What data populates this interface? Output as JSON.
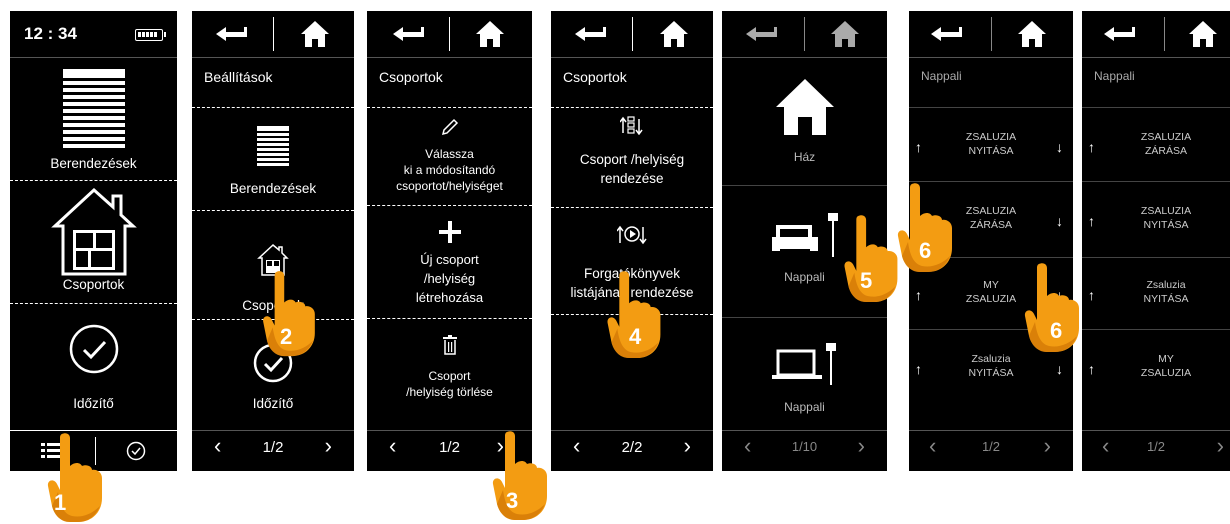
{
  "screen1": {
    "time": "12 : 34",
    "items": [
      "Berendezések",
      "Csoportok",
      "Időzítő"
    ]
  },
  "screen2": {
    "title": "Beállítások",
    "items": [
      "Berendezések",
      "Csoportok",
      "Időzítő"
    ],
    "pager": "1/2"
  },
  "screen3": {
    "title": "Csoportok",
    "items": [
      [
        "Válassza",
        "ki a módosítandó",
        "csoportot/helyiséget"
      ],
      [
        "Új csoport",
        "/helyiség",
        "létrehozása"
      ],
      [
        "Csoport",
        "/helyiség törlése"
      ]
    ],
    "pager": "1/2"
  },
  "screen4": {
    "title": "Csoportok",
    "items": [
      [
        "Csoport /helyiség",
        "rendezése"
      ],
      [
        "Forgatókönyvek",
        "listájának rendezése"
      ]
    ],
    "pager": "2/2"
  },
  "screen5": {
    "items": [
      "Ház",
      "Nappali",
      "Nappali"
    ],
    "pager": "1/10"
  },
  "screen6": {
    "title": "Nappali",
    "rows": [
      [
        "ZSALUZIA",
        "NYITÁSA"
      ],
      [
        "ZSALUZIA",
        "ZÁRÁSA"
      ],
      [
        "MY",
        "ZSALUZIA"
      ],
      [
        "Zsaluzia",
        "NYITÁSA"
      ]
    ],
    "pager": "1/2"
  },
  "screen7": {
    "title": "Nappali",
    "rows": [
      [
        "ZSALUZIA",
        "ZÁRÁSA"
      ],
      [
        "ZSALUZIA",
        "NYITÁSA"
      ],
      [
        "Zsaluzia",
        "NYITÁSA"
      ],
      [
        "MY",
        "ZSALUZIA"
      ]
    ],
    "pager": "1/2"
  },
  "steps": [
    "1",
    "2",
    "3",
    "4",
    "5",
    "6",
    "6"
  ],
  "colors": {
    "hand": "#f39c12",
    "screen": "#000000"
  }
}
